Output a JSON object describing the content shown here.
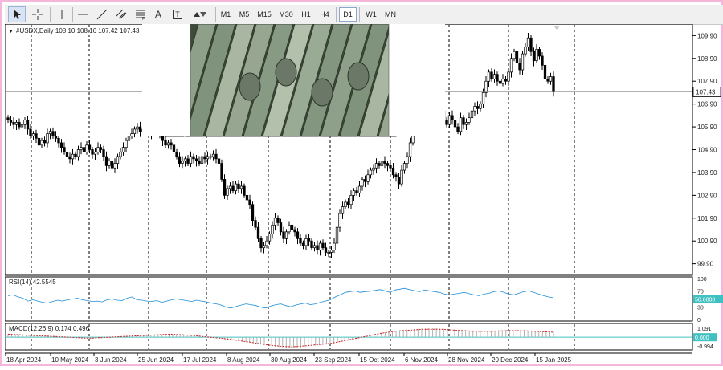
{
  "toolbar": {
    "timeframes": [
      "M1",
      "M5",
      "M15",
      "M30",
      "H1",
      "H4",
      "D1",
      "W1",
      "MN"
    ],
    "active_timeframe": "D1",
    "tools": [
      "cursor-icon",
      "crosshair-icon",
      "vertical-line-icon",
      "horizontal-line-icon",
      "trend-line-icon",
      "channel-icon",
      "fibonacci-icon",
      "text-icon",
      "label-icon",
      "arrows-icon"
    ],
    "text_tool_label": "A",
    "label_tool_label": "T"
  },
  "main": {
    "symbol_info": "#USDX,Daily  108.10 108.16 107.42 107.43",
    "current_price": "107.43",
    "price_ticks": [
      "109.90",
      "108.90",
      "107.90",
      "106.90",
      "105.90",
      "104.90",
      "103.90",
      "102.90",
      "101.90",
      "100.90",
      "99.90"
    ],
    "candle_up_color": "#000000",
    "candle_down_color": "#000000",
    "price_line_color": "#808080"
  },
  "rsi": {
    "label": "RSI(14) 42.5545",
    "ticks": [
      "100",
      "70",
      "50.0000",
      "30",
      "0"
    ],
    "current_label": "50.0000",
    "line_color": "#1f8dd6",
    "level_color": "#40c0c0"
  },
  "macd": {
    "label": "MACD(12,26,9) 0.174 0.496",
    "ticks": [
      "1.091",
      "0.000",
      "-0.994"
    ],
    "current_label": "0.000",
    "histogram_color": "#b0b0b0",
    "signal_color": "#d02020"
  },
  "time_axis": {
    "labels": [
      "18 Apr 2024",
      "10 May 2024",
      "3 Jun 2024",
      "25 Jun 2024",
      "17 Jul 2024",
      "8 Aug 2024",
      "30 Aug 2024",
      "23 Sep 2024",
      "15 Oct 2024",
      "6 Nov 2024",
      "28 Nov 2024",
      "20 Dec 2024",
      "15 Jan 2025"
    ]
  },
  "chart_data": {
    "type": "candlestick",
    "title": "#USDX,Daily",
    "ylim": [
      99.5,
      110.3
    ],
    "closes": [
      106.2,
      106.1,
      106.0,
      106.1,
      105.9,
      106.0,
      106.2,
      105.8,
      105.5,
      105.6,
      105.4,
      105.1,
      105.3,
      105.2,
      105.6,
      105.7,
      105.5,
      105.4,
      105.2,
      105.0,
      104.8,
      104.6,
      104.5,
      104.7,
      104.6,
      104.9,
      105.0,
      104.8,
      105.1,
      104.9,
      104.7,
      104.8,
      105.0,
      104.9,
      104.6,
      104.2,
      104.4,
      104.1,
      104.3,
      104.6,
      104.8,
      105.0,
      105.3,
      105.5,
      105.6,
      105.8,
      105.9,
      105.7,
      105.8,
      106.0,
      105.8,
      105.6,
      105.8,
      105.9,
      105.6,
      105.3,
      105.1,
      105.2,
      105.1,
      104.8,
      104.6,
      104.3,
      104.4,
      104.5,
      104.3,
      104.6,
      104.5,
      104.4,
      104.3,
      104.6,
      104.5,
      104.6,
      104.6,
      104.7,
      104.5,
      104.3,
      103.6,
      102.9,
      103.2,
      103.3,
      103.1,
      103.4,
      103.2,
      103.3,
      102.9,
      102.7,
      102.5,
      101.8,
      101.5,
      101.0,
      100.6,
      100.7,
      100.9,
      101.2,
      101.6,
      101.9,
      101.7,
      101.3,
      101.0,
      101.3,
      101.6,
      101.4,
      101.3,
      101.0,
      100.8,
      100.7,
      101.0,
      100.9,
      100.6,
      100.7,
      100.5,
      100.8,
      100.6,
      100.4,
      100.4,
      100.5,
      100.8,
      101.5,
      102.1,
      102.4,
      102.6,
      102.5,
      102.9,
      103.1,
      103.0,
      103.3,
      103.6,
      103.5,
      103.8,
      104.0,
      104.1,
      104.3,
      104.2,
      104.4,
      104.3,
      104.2,
      104.1,
      103.8,
      103.7,
      103.4,
      104.0,
      104.3,
      104.6,
      105.2,
      105.9,
      106.5,
      106.9,
      106.5,
      106.8,
      107.0,
      106.8,
      106.6,
      106.9,
      107.3,
      106.6,
      106.2,
      106.0,
      106.4,
      106.2,
      105.9,
      105.7,
      106.3,
      106.0,
      106.1,
      106.3,
      106.6,
      106.8,
      106.7,
      106.9,
      107.4,
      107.9,
      108.3,
      108.0,
      108.2,
      107.9,
      107.8,
      108.0,
      107.9,
      108.3,
      108.9,
      109.2,
      108.7,
      108.4,
      109.1,
      109.4,
      109.8,
      109.2,
      108.8,
      109.3,
      109.0,
      108.6,
      108.0,
      107.9,
      108.1,
      107.43
    ],
    "rsi": {
      "values": [
        58,
        60,
        55,
        52,
        45,
        48,
        45,
        42,
        40,
        44,
        47,
        45,
        48,
        50,
        52,
        48,
        46,
        44,
        45,
        43,
        48,
        50,
        47,
        46,
        52,
        55,
        48,
        47,
        45,
        44,
        46,
        42,
        45,
        48,
        50,
        48,
        46,
        44,
        47,
        45,
        43,
        40,
        38,
        35,
        30,
        28,
        32,
        35,
        38,
        36,
        34,
        30,
        28,
        33,
        36,
        38,
        34,
        31,
        35,
        38,
        40,
        36,
        38,
        42,
        45,
        48,
        55,
        60,
        66,
        68,
        70,
        66,
        68,
        69,
        71,
        73,
        70,
        66,
        72,
        74,
        76,
        73,
        70,
        68,
        72,
        70,
        68,
        66,
        62,
        60,
        62,
        64,
        66,
        63,
        60,
        58,
        62,
        64,
        68,
        70,
        66,
        62,
        60,
        64,
        68,
        70,
        66,
        62,
        58,
        55,
        53
      ],
      "levels": [
        70,
        50,
        30
      ]
    },
    "macd": {
      "signal": [
        0.3,
        0.25,
        0.2,
        0.15,
        0.1,
        0.05,
        0.0,
        -0.05,
        -0.1,
        -0.05,
        0.0,
        0.05,
        0.1,
        0.15,
        0.2,
        0.25,
        0.3,
        0.25,
        0.2,
        0.1,
        0.0,
        -0.1,
        -0.2,
        -0.35,
        -0.5,
        -0.65,
        -0.8,
        -0.9,
        -0.95,
        -0.9,
        -0.8,
        -0.7,
        -0.6,
        -0.4,
        -0.2,
        0.0,
        0.2,
        0.4,
        0.55,
        0.65,
        0.72,
        0.78,
        0.8,
        0.78,
        0.72,
        0.65,
        0.6,
        0.58,
        0.6,
        0.64,
        0.66,
        0.64,
        0.6,
        0.55,
        0.5
      ]
    }
  }
}
